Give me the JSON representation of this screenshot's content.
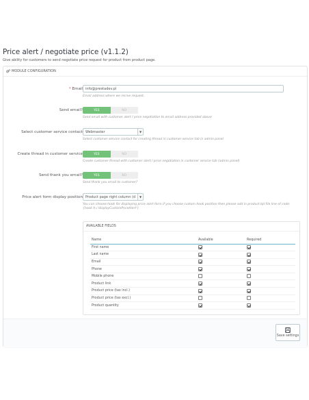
{
  "page": {
    "title": "Price alert / negotiate price (v1.1.2)",
    "description": "Give ability for customers to send negotiate price request for product from product page."
  },
  "panel": {
    "heading": "MODULE CONFIGURATION",
    "heading_icon": "cogs-icon"
  },
  "form": {
    "email": {
      "label": "Email",
      "required_mark": "*",
      "value": "info@prestadev.pl",
      "help": "Email address where we recive request."
    },
    "send_email": {
      "label": "Send email?",
      "yes": "YES",
      "no": "NO",
      "selected": "YES",
      "help": "Send email with customer alert / price negotiation to email address provided above"
    },
    "service_contact": {
      "label": "Select customer service contact",
      "value": "Webmaster",
      "help": "Select customer service contact for creating thread in customer service tab in admin panel"
    },
    "create_thread": {
      "label": "Create thread in customer service",
      "yes": "YES",
      "no": "NO",
      "selected": "YES",
      "help": "Create customer thread with customer alert / price negotiation in customer service tab (admin panel)"
    },
    "thank_you": {
      "label": "Send thank you email?",
      "yes": "YES",
      "no": "NO",
      "selected": "YES",
      "help": "Send thank you email to customer?"
    },
    "display_position": {
      "label": "Price alert form display position",
      "value": "Product page right column (d",
      "help": "You can choose hook for displaying price alert form if you choose custom hook position then please add in product.tpl file line of code: {hook h='displayCustomPriceAlert'}"
    }
  },
  "fields": {
    "heading": "AVAILABLE FIELDS",
    "columns": [
      "Name",
      "Available",
      "Required"
    ],
    "rows": [
      {
        "name": "First name",
        "available": true,
        "required": true
      },
      {
        "name": "Last name",
        "available": true,
        "required": true
      },
      {
        "name": "Email",
        "available": true,
        "required": true
      },
      {
        "name": "Phone",
        "available": true,
        "required": true
      },
      {
        "name": "Mobile phone",
        "available": false,
        "required": false
      },
      {
        "name": "Product link",
        "available": true,
        "required": true
      },
      {
        "name": "Product price (tax incl.)",
        "available": true,
        "required": true
      },
      {
        "name": "Product price (tax excl.)",
        "available": false,
        "required": false
      },
      {
        "name": "Product quantity",
        "available": true,
        "required": true
      }
    ]
  },
  "footer": {
    "save_label": "Save settings",
    "save_icon": "floppy-disk-icon"
  },
  "colors": {
    "switch_on": "#72c279",
    "required": "#e74c3c",
    "table_header_border": "#6ab7c9"
  }
}
